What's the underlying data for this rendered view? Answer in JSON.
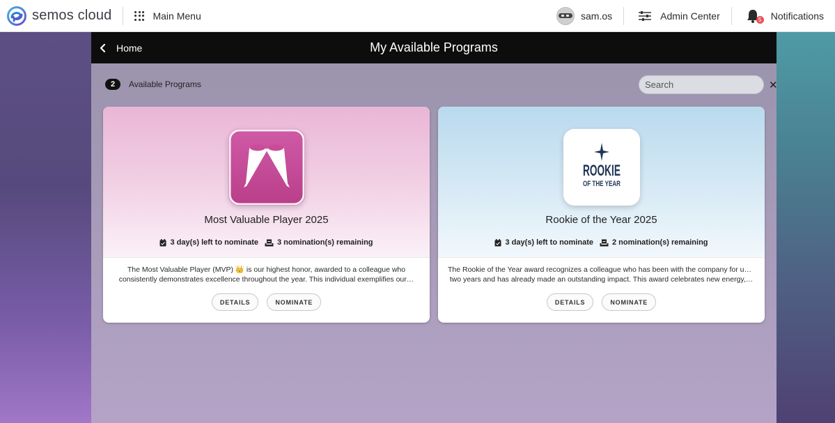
{
  "topbar": {
    "brand": "semos cloud",
    "main_menu_label": "Main Menu",
    "user_name": "sam.os",
    "admin_label": "Admin Center",
    "notifications_label": "Notifications",
    "notifications_count": "5"
  },
  "header": {
    "back_label": "Home",
    "title": "My Available Programs"
  },
  "toolbar": {
    "count": "2",
    "count_label": "Available Programs",
    "search_placeholder": "Search"
  },
  "programs": [
    {
      "title": "Most Valuable Player 2025",
      "days_left": "3 day(s) left to nominate",
      "nominations_remaining": "3 nomination(s) remaining",
      "description_line1": "The Most Valuable Player (MVP) 👑 is our highest honor, awarded to a colleague who",
      "description_line2": "consistently demonstrates excellence throughout the year. This individual exemplifies our…",
      "details_label": "DETAILS",
      "nominate_label": "NOMINATE",
      "logo_color": "#c94b9a"
    },
    {
      "title": "Rookie of the Year 2025",
      "days_left": "3 day(s) left to nominate",
      "nominations_remaining": "2 nomination(s) remaining",
      "description_line1": "The Rookie of the Year award recognizes a colleague who has been with the company for up to",
      "description_line2": "two years and has already made an outstanding impact. This award celebrates new energy,…",
      "details_label": "DETAILS",
      "nominate_label": "NOMINATE",
      "logo_text_line1": "ROOKIE",
      "logo_text_line2": "OF THE YEAR",
      "logo_color": "#1f3557"
    }
  ]
}
